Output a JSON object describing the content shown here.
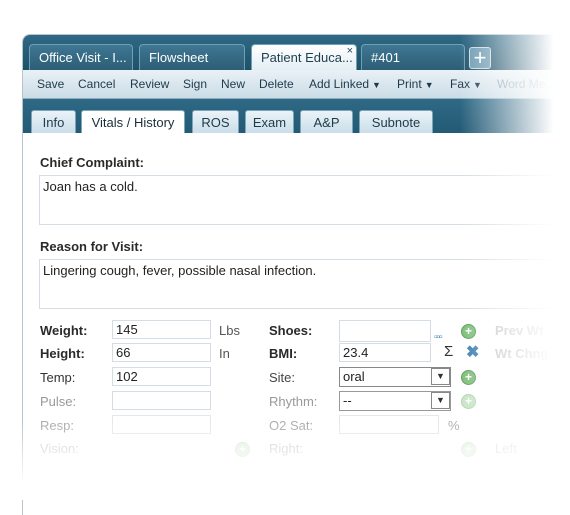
{
  "doc_tabs": [
    "Office Visit - I...",
    "Flowsheet",
    "Patient Educa...",
    "#401"
  ],
  "tab_close": "×",
  "add_tab": "+",
  "toolbar": {
    "save": "Save",
    "cancel": "Cancel",
    "review": "Review",
    "sign": "Sign",
    "new": "New",
    "delete": "Delete",
    "add_linked": "Add Linked",
    "print": "Print",
    "fax": "Fax",
    "word_merge": "Word Me..."
  },
  "sub_tabs": [
    "Info",
    "Vitals / History",
    "ROS",
    "Exam",
    "A&P",
    "Subnote"
  ],
  "chief_complaint": {
    "label": "Chief Complaint:",
    "value": "Joan has a cold."
  },
  "reason": {
    "label": "Reason for Visit:",
    "value": "Lingering cough, fever, possible nasal infection."
  },
  "vitals": {
    "weight": {
      "label": "Weight:",
      "value": "145",
      "unit": "Lbs"
    },
    "height": {
      "label": "Height:",
      "value": "66",
      "unit": "In"
    },
    "temp": {
      "label": "Temp:",
      "value": "102"
    },
    "pulse": {
      "label": "Pulse:"
    },
    "resp": {
      "label": "Resp:"
    },
    "vision": {
      "label": "Vision:"
    },
    "shoes": {
      "label": "Shoes:"
    },
    "bmi": {
      "label": "BMI:",
      "value": "23.4"
    },
    "site": {
      "label": "Site:",
      "value": "oral"
    },
    "rhythm": {
      "label": "Rhythm:",
      "value": "--"
    },
    "o2sat": {
      "label": "O2 Sat:",
      "unit": "%"
    },
    "right": {
      "label": "Right:"
    },
    "prev_wt": "Prev Wt",
    "wt_chng": "Wt Chng",
    "left": "Left"
  },
  "icons": {
    "sigma": "Σ",
    "clear": "✖",
    "dots": "▫▫▫",
    "add": "+"
  }
}
